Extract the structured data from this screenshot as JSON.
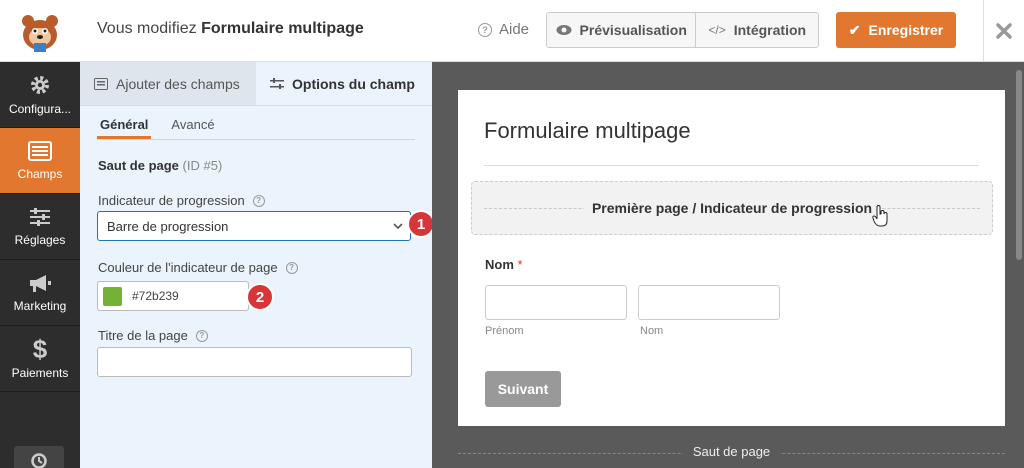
{
  "header": {
    "title_prefix": "Vous modifiez",
    "form_name": "Formulaire multipage",
    "help_label": "Aide",
    "preview_label": "Prévisualisation",
    "embed_label": "Intégration",
    "save_label": "Enregistrer"
  },
  "sidebar": {
    "items": [
      {
        "label": "Configura...",
        "icon": "gear-icon"
      },
      {
        "label": "Champs",
        "icon": "fields-icon"
      },
      {
        "label": "Réglages",
        "icon": "sliders-icon"
      },
      {
        "label": "Marketing",
        "icon": "megaphone-icon"
      },
      {
        "label": "Paiements",
        "icon": "dollar-icon"
      }
    ]
  },
  "panel": {
    "tab_add": "Ajouter des champs",
    "tab_options": "Options du champ",
    "subtab_general": "Général",
    "subtab_advanced": "Avancé",
    "section_title": "Saut de page",
    "section_id": "(ID #5)",
    "progress_label": "Indicateur de progression",
    "progress_value": "Barre de progression",
    "color_label": "Couleur de l'indicateur de page",
    "color_value": "#72b239",
    "page_title_label": "Titre de la page",
    "page_title_value": "",
    "badge1": "1",
    "badge2": "2"
  },
  "preview": {
    "form_title": "Formulaire multipage",
    "progress_box": "Première page / Indicateur de progression",
    "name_label": "Nom",
    "required_mark": "*",
    "first_sub": "Prénom",
    "last_sub": "Nom",
    "next_label": "Suivant",
    "page_break": "Saut de page"
  },
  "colors": {
    "accent": "#e27730",
    "swatch": "#72b239",
    "badge": "#d63638"
  }
}
